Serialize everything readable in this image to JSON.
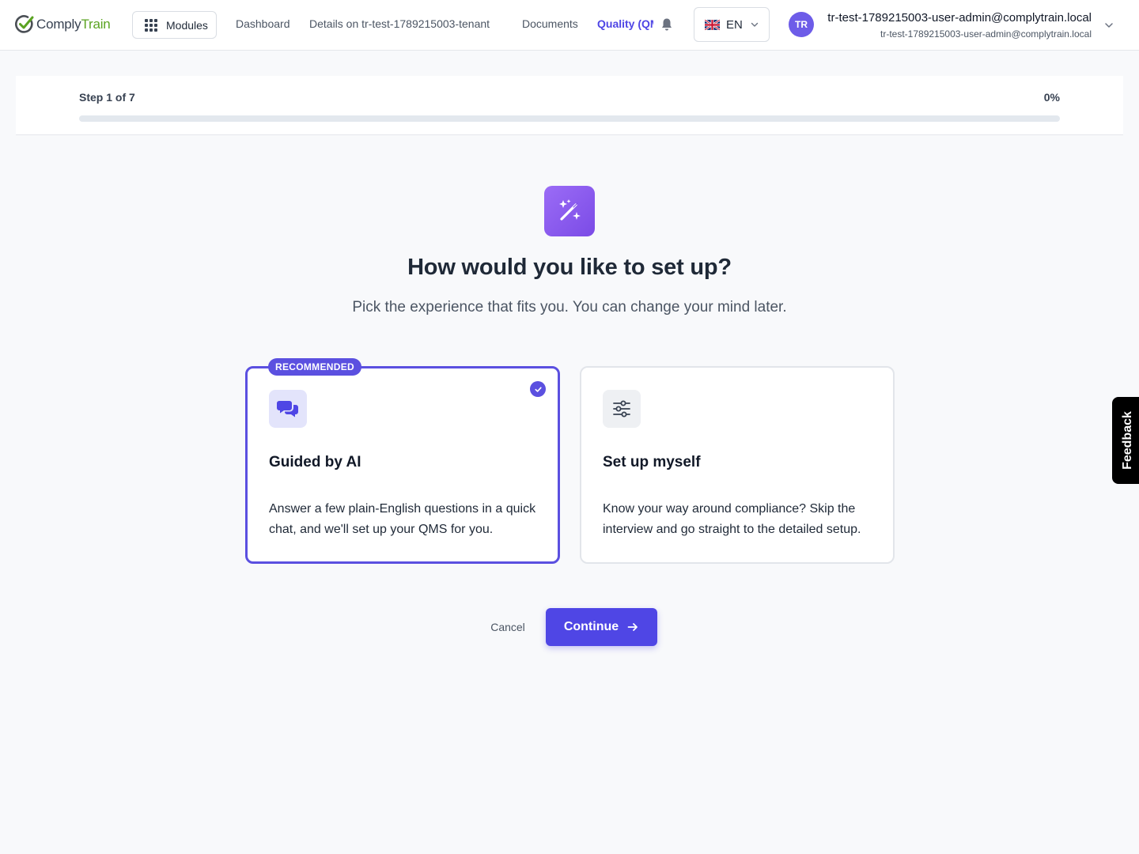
{
  "app": {
    "logo": {
      "part1": "Comply",
      "part2": "Train",
      "check_color": "#4a4f55",
      "accent": "#5aa321"
    }
  },
  "header": {
    "modules_label": "Modules",
    "nav": [
      {
        "label": "Dashboard",
        "active": false
      },
      {
        "label": "Details on tr-test-1789215003-tenant",
        "active": false
      },
      {
        "label": "Documents",
        "active": false
      },
      {
        "label": "Quality (QMS)",
        "active": true
      }
    ],
    "notifications_icon": "bell-icon",
    "language": {
      "code": "EN",
      "flag": "uk-flag-icon"
    },
    "user": {
      "initials": "TR",
      "name": "tr-test-1789215003-user-admin@complytrain.local",
      "email": "tr-test-1789215003-user-admin@complytrain.local"
    }
  },
  "progress": {
    "step_label": "Step 1 of 7",
    "percent_label": "0%",
    "fraction": 0
  },
  "wizard": {
    "icon": "magic-wand-icon",
    "title": "How would you like to set up?",
    "subtitle": "Pick the experience that fits you. You can change your mind later.",
    "options": [
      {
        "badge": "RECOMMENDED",
        "icon": "chat-bubbles-icon",
        "title": "Guided by AI",
        "description": "Answer a few plain-English questions in a quick chat, and we'll set up your QMS for you.",
        "selected": true
      },
      {
        "icon": "sliders-icon",
        "title": "Set up myself",
        "description": "Know your way around compliance? Skip the interview and go straight to the detailed setup.",
        "selected": false
      }
    ],
    "cancel_label": "Cancel",
    "continue_label": "Continue"
  },
  "feedback_label": "Feedback",
  "colors": {
    "primary": "#4f46e5",
    "selected_border": "#5b50e0",
    "hero_gradient_start": "#9b6cf6",
    "hero_gradient_end": "#7b4be6",
    "page_background": "#f8f9fb"
  }
}
